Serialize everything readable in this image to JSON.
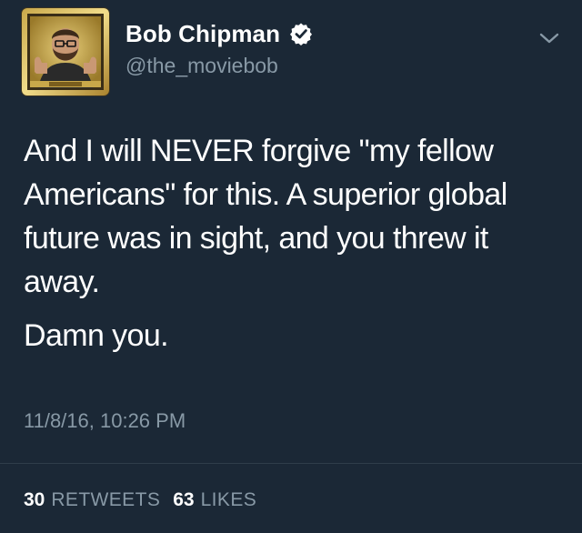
{
  "author": {
    "display_name": "Bob Chipman",
    "handle": "@the_moviebob",
    "verified": true,
    "avatar_icon": "profile-photo-gold-frame"
  },
  "tweet": {
    "paragraphs": [
      "And I will NEVER forgive \"my fellow Americans\" for this. A superior global future was in sight, and you threw it away.",
      "Damn you."
    ],
    "timestamp": "11/8/16, 10:26 PM"
  },
  "stats": {
    "retweets_count": "30",
    "retweets_label": "RETWEETS",
    "likes_count": "63",
    "likes_label": "LIKES"
  },
  "colors": {
    "background": "#1b2836",
    "secondary_text": "#8899a6",
    "primary_text": "#ffffff",
    "divider": "#2f3d4a"
  },
  "icons": {
    "verified": "verified-badge-icon",
    "more": "chevron-down-icon"
  }
}
